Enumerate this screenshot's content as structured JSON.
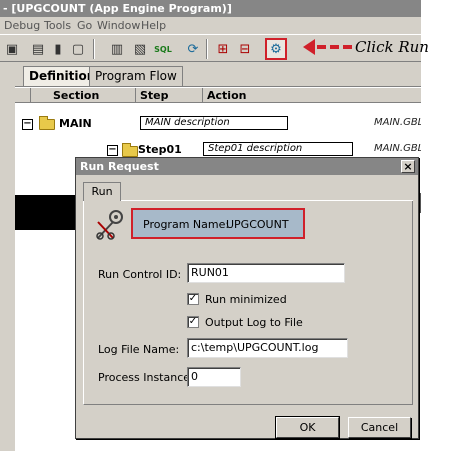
{
  "window": {
    "title": "- [UPGCOUNT (App Engine Program)]"
  },
  "menu": {
    "items": [
      "Debug",
      "Tools",
      "Go",
      "Window",
      "Help"
    ]
  },
  "toolbar": {
    "icons": [
      "toggle-icon",
      "properties-icon",
      "database-icon",
      "window-icon",
      "page-icon",
      "page2-icon",
      "sql-icon",
      "refresh-icon",
      "insert-icon",
      "delete-icon",
      "run-icon"
    ]
  },
  "annotation": {
    "text": "Click Run",
    "arrow": "← - -",
    "color": "#d0202a"
  },
  "tabs": {
    "definition": "Definition",
    "program_flow": "Program Flow"
  },
  "columns": {
    "section": "Section",
    "step": "Step",
    "action": "Action"
  },
  "tree": {
    "section": {
      "name": "MAIN",
      "description": "MAIN description",
      "gbl": "MAIN.GBL"
    },
    "step": {
      "name": "Step01",
      "description": "Step01 description",
      "gbl": "MAIN.GBL"
    }
  },
  "dialog": {
    "title": "Run Request",
    "close": "×",
    "tab": "Run",
    "program_name_label": "Program Name:",
    "program_name_value": "UPGCOUNT",
    "run_control_label": "Run Control ID:",
    "run_control_value": "RUN01",
    "run_minimized_label": "Run minimized",
    "run_minimized_checked": true,
    "output_log_label": "Output Log to File",
    "output_log_checked": true,
    "log_file_label": "Log File Name:",
    "log_file_value": "c:\\temp\\UPGCOUNT.log",
    "process_instance_label": "Process Instance:",
    "process_instance_value": "0",
    "ok_label": "OK",
    "cancel_label": "Cancel",
    "check_mark": "✓"
  },
  "colors": {
    "highlight_border": "#d0202a",
    "program_box": "#a7b9c9",
    "titlebar": "#868686",
    "chrome": "#d4d0c8"
  }
}
